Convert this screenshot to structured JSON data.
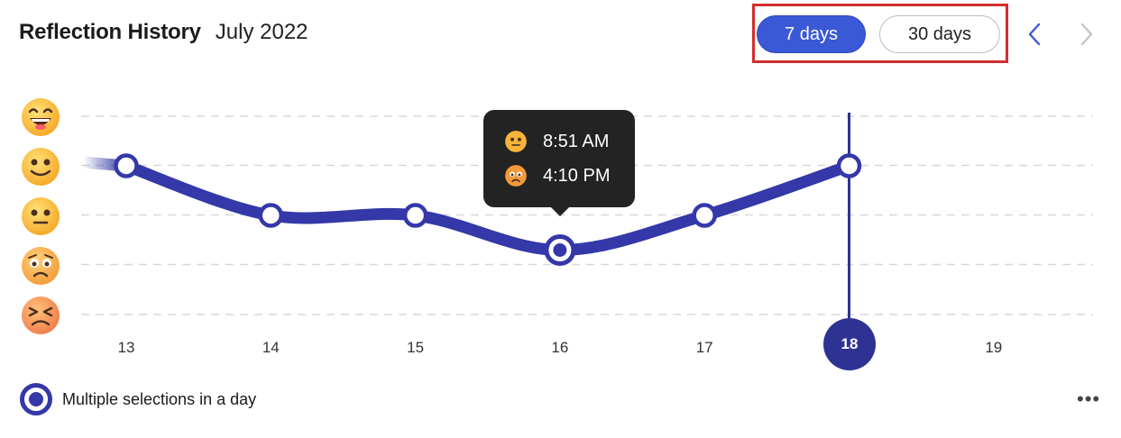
{
  "header": {
    "title": "Reflection History",
    "month": "July 2022"
  },
  "range": {
    "seven_label": "7 days",
    "thirty_label": "30 days",
    "selected": "7 days"
  },
  "nav": {
    "prev_icon": "chevron-left-icon",
    "next_icon": "chevron-right-icon"
  },
  "mood_scale": [
    "grinning",
    "smiling",
    "neutral",
    "worried",
    "distressed"
  ],
  "tooltip": {
    "entries": [
      {
        "mood": "neutral",
        "time": "8:51 AM"
      },
      {
        "mood": "worried",
        "time": "4:10 PM"
      }
    ]
  },
  "chart_data": {
    "type": "line",
    "x": [
      "13",
      "14",
      "15",
      "16",
      "17",
      "18",
      "19"
    ],
    "y_levels": [
      "grinning",
      "smiling",
      "neutral",
      "worried",
      "distressed"
    ],
    "series": [
      {
        "values": [
          4,
          3,
          3,
          2.3,
          3,
          4,
          null
        ]
      }
    ],
    "multiple_selection_days": [
      "16"
    ],
    "selected_day": "18",
    "line_color": "#3438a8",
    "grid": true
  },
  "legend": {
    "label": "Multiple selections in a day"
  },
  "more_label": "•••"
}
